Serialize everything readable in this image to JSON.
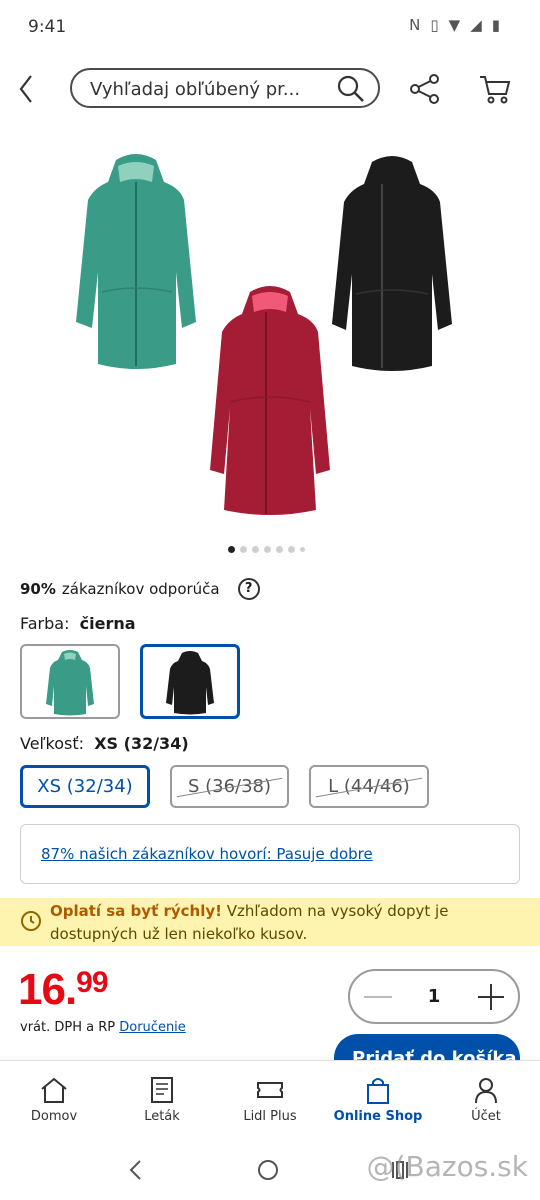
{
  "status_bar": {
    "time": "9:41"
  },
  "search": {
    "placeholder": "Vyhľadaj obľúbený pr..."
  },
  "gallery": {
    "image_count": 7,
    "active_index": 0
  },
  "recommend": {
    "percent": "90%",
    "text": "zákazníkov odporúča"
  },
  "color": {
    "label": "Farba:",
    "selected": "čierna",
    "options": [
      "zelená",
      "čierna"
    ],
    "selected_index": 1
  },
  "size": {
    "label": "Veľkosť:",
    "selected": "XS (32/34)",
    "options": [
      {
        "label": "XS (32/34)",
        "available": true
      },
      {
        "label": "S (36/38)",
        "available": false
      },
      {
        "label": "L (44/46)",
        "available": false
      }
    ]
  },
  "fit": {
    "text": "87% našich zákazníkov hovorí:  Pasuje dobre"
  },
  "alert": {
    "bold": "Oplatí sa byť rýchly!",
    "text": " Vzhľadom na vysoký dopyt je dostupných už len niekoľko kusov."
  },
  "price": {
    "integer": "16.",
    "decimal": "99",
    "vat": "vrát. DPH a RP",
    "delivery": "Doručenie"
  },
  "quantity": {
    "value": "1"
  },
  "add_to_cart": {
    "label": "Pridať do košíka"
  },
  "bottom_nav": {
    "items": [
      {
        "label": "Domov",
        "icon": "home-icon"
      },
      {
        "label": "Leták",
        "icon": "flyer-icon"
      },
      {
        "label": "Lidl Plus",
        "icon": "ticket-icon"
      },
      {
        "label": "Online Shop",
        "icon": "shopping-bag-icon"
      },
      {
        "label": "Účet",
        "icon": "user-icon"
      }
    ],
    "active_index": 3
  },
  "watermark": "@(Bazos.sk",
  "colors": {
    "accent": "#0050aa",
    "price": "#e60a14",
    "alert_bg": "#fff3b0"
  }
}
